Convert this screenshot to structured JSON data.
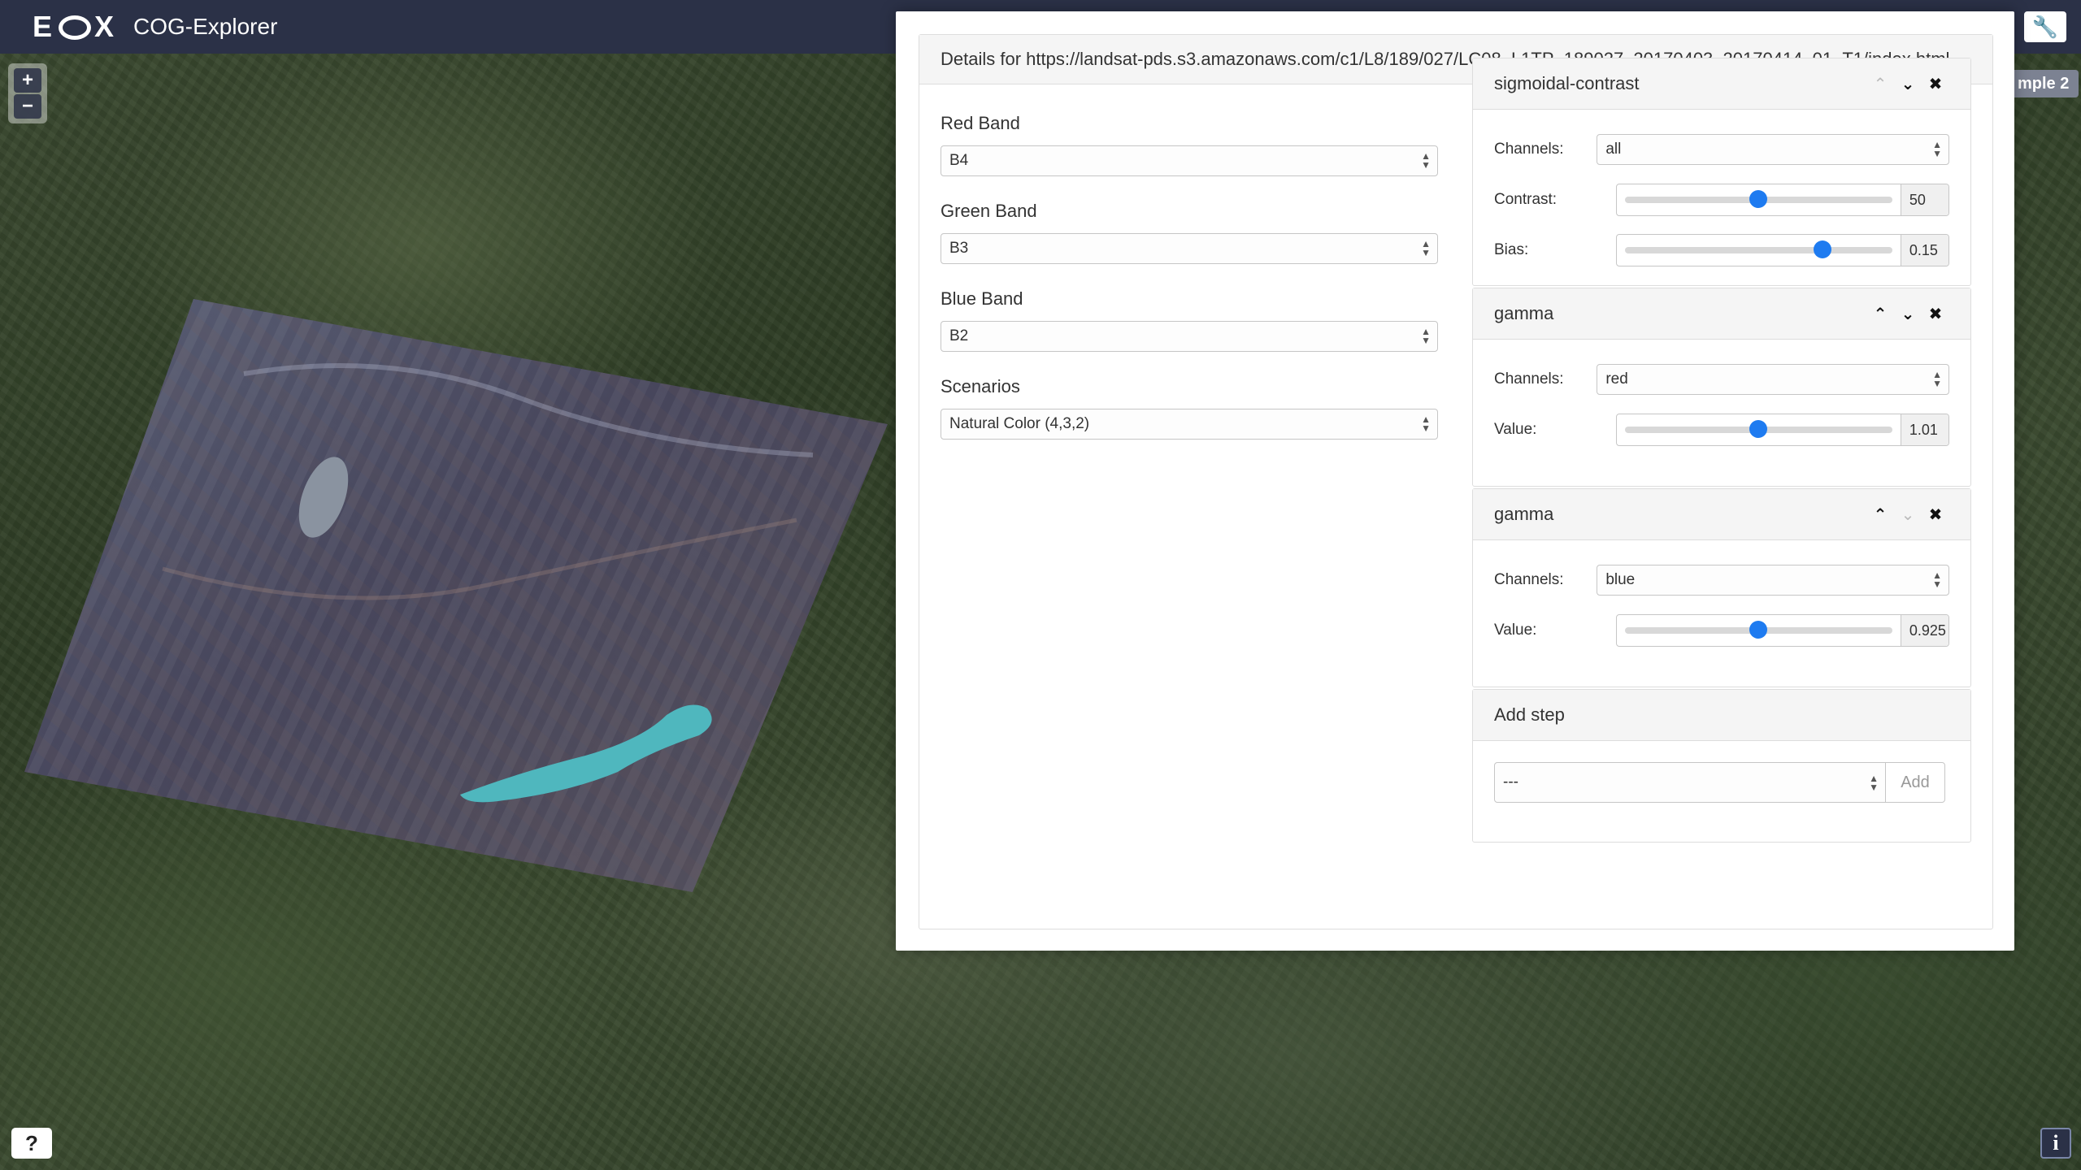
{
  "header": {
    "logo": "E X",
    "title": "COG-Explorer"
  },
  "zoom": {
    "in_label": "+",
    "out_label": "−"
  },
  "help_label": "?",
  "info_label": "i",
  "example_label": "mple 2",
  "details": {
    "title": "Details for https://landsat-pds.s3.amazonaws.com/c1/L8/189/027/LC08_L1TP_189027_20170403_20170414_01_T1/index.html",
    "red_band": {
      "label": "Red Band",
      "value": "B4"
    },
    "green_band": {
      "label": "Green Band",
      "value": "B3"
    },
    "blue_band": {
      "label": "Blue Band",
      "value": "B2"
    },
    "scenarios": {
      "label": "Scenarios",
      "value": "Natural Color (4,3,2)"
    }
  },
  "pipeline": {
    "sigmoidal": {
      "title": "sigmoidal-contrast",
      "channels_label": "Channels:",
      "channels_value": "all",
      "contrast_label": "Contrast:",
      "contrast_value": "50",
      "contrast_fraction": 0.5,
      "bias_label": "Bias:",
      "bias_value": "0.15",
      "bias_fraction": 0.74
    },
    "gamma1": {
      "title": "gamma",
      "channels_label": "Channels:",
      "channels_value": "red",
      "value_label": "Value:",
      "value": "1.01",
      "value_fraction": 0.5
    },
    "gamma2": {
      "title": "gamma",
      "channels_label": "Channels:",
      "channels_value": "blue",
      "value_label": "Value:",
      "value": "0.925",
      "value_fraction": 0.5
    },
    "add_step": {
      "title": "Add step",
      "select_value": "---",
      "button_label": "Add"
    }
  },
  "icons": {
    "up": "⌃",
    "down": "⌄",
    "close": "✖",
    "wrench": "🔧"
  },
  "colors": {
    "header": "#2b3147",
    "slider_thumb": "#1e7bf0"
  }
}
